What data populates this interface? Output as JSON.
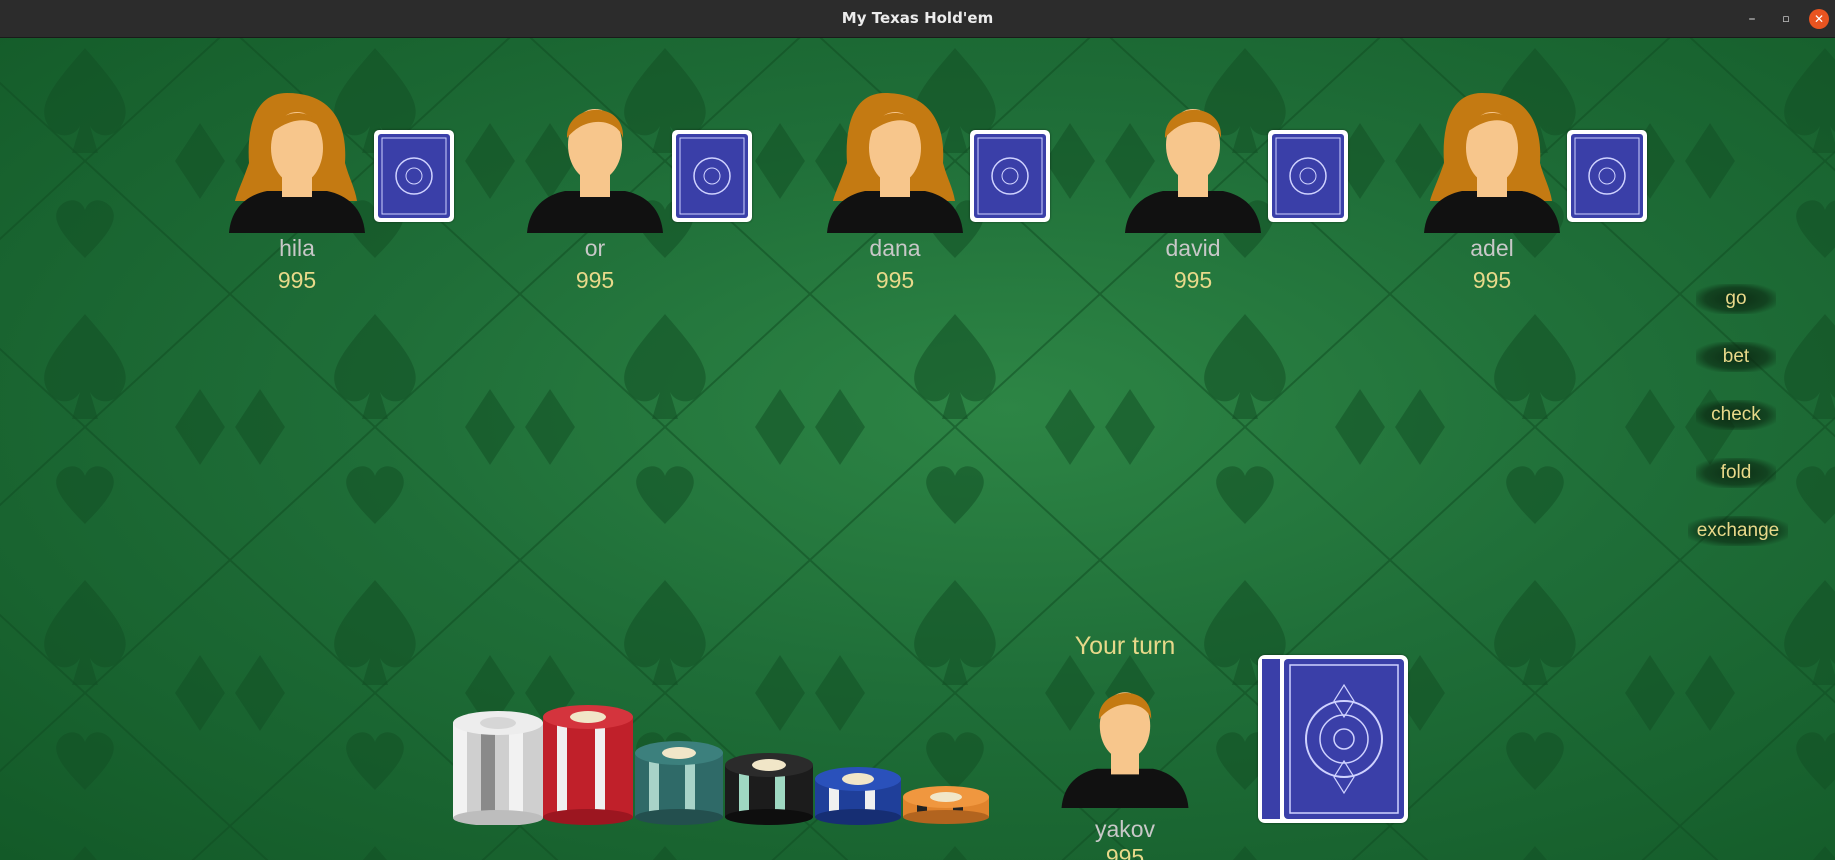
{
  "window": {
    "title": "My Texas Hold'em",
    "controls": {
      "minimize": "–",
      "maximize": "▫",
      "close": "✕"
    }
  },
  "opponents": [
    {
      "name": "hila",
      "chips": "995",
      "avatar": "female-avatar-icon"
    },
    {
      "name": "or",
      "chips": "995",
      "avatar": "male-avatar-icon"
    },
    {
      "name": "dana",
      "chips": "995",
      "avatar": "female-avatar-icon"
    },
    {
      "name": "david",
      "chips": "995",
      "avatar": "male-avatar-icon"
    },
    {
      "name": "adel",
      "chips": "995",
      "avatar": "female-avatar-icon"
    }
  ],
  "player": {
    "name": "yakov",
    "chips": "995",
    "status": "Your turn",
    "avatar": "male-avatar-icon"
  },
  "actions": [
    "go",
    "bet",
    "check",
    "fold",
    "exchange"
  ],
  "colors": {
    "felt": "#1f6e38",
    "card_back": "#3a3fa8",
    "label_gold": "#e8d98a",
    "name_gray": "#c8c8c8",
    "chip_colors": [
      "#d9d9d9",
      "#c0202a",
      "#2f6a68",
      "#1c1c1c",
      "#1f3f9a",
      "#e0832c"
    ]
  }
}
